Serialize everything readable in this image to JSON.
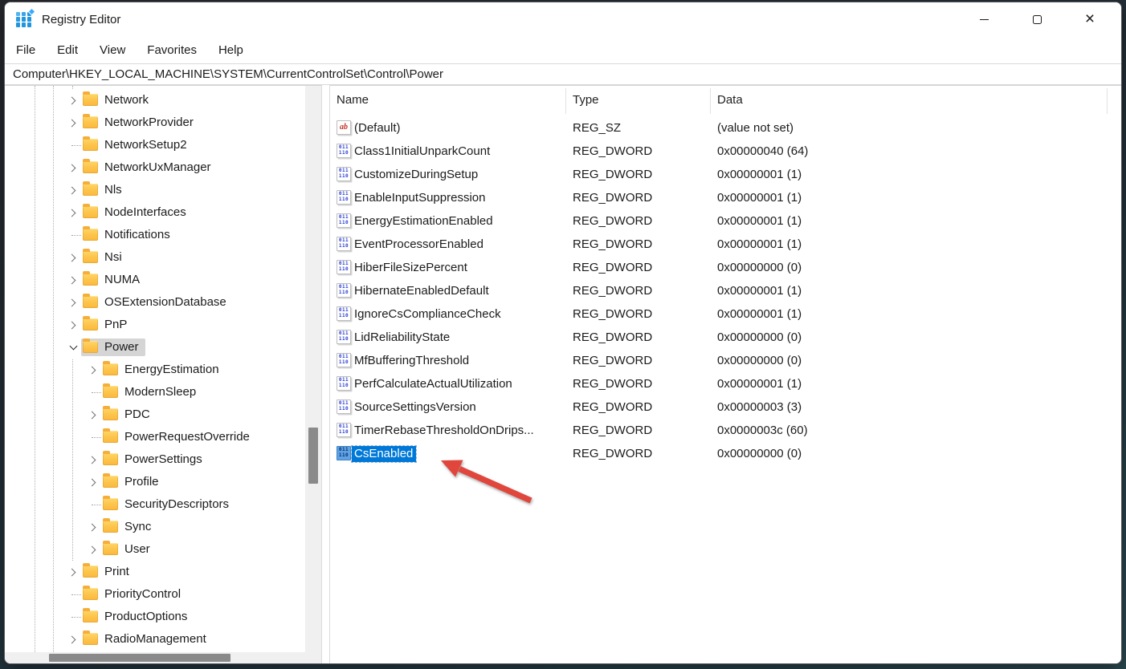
{
  "window": {
    "title": "Registry Editor",
    "controls": {
      "minimize": "minimize",
      "maximize": "maximize",
      "close": "close"
    }
  },
  "menu": {
    "items": [
      "File",
      "Edit",
      "View",
      "Favorites",
      "Help"
    ]
  },
  "address_bar": {
    "value": "Computer\\HKEY_LOCAL_MACHINE\\SYSTEM\\CurrentControlSet\\Control\\Power"
  },
  "tree": {
    "items": [
      {
        "label": "Network",
        "depth": 0,
        "expander": "collapsed",
        "selected": false
      },
      {
        "label": "NetworkProvider",
        "depth": 0,
        "expander": "collapsed",
        "selected": false
      },
      {
        "label": "NetworkSetup2",
        "depth": 0,
        "expander": "none",
        "selected": false
      },
      {
        "label": "NetworkUxManager",
        "depth": 0,
        "expander": "collapsed",
        "selected": false
      },
      {
        "label": "Nls",
        "depth": 0,
        "expander": "collapsed",
        "selected": false
      },
      {
        "label": "NodeInterfaces",
        "depth": 0,
        "expander": "collapsed",
        "selected": false
      },
      {
        "label": "Notifications",
        "depth": 0,
        "expander": "none",
        "selected": false
      },
      {
        "label": "Nsi",
        "depth": 0,
        "expander": "collapsed",
        "selected": false
      },
      {
        "label": "NUMA",
        "depth": 0,
        "expander": "collapsed",
        "selected": false
      },
      {
        "label": "OSExtensionDatabase",
        "depth": 0,
        "expander": "collapsed",
        "selected": false
      },
      {
        "label": "PnP",
        "depth": 0,
        "expander": "collapsed",
        "selected": false
      },
      {
        "label": "Power",
        "depth": 0,
        "expander": "expanded",
        "selected": true
      },
      {
        "label": "EnergyEstimation",
        "depth": 1,
        "expander": "collapsed",
        "selected": false
      },
      {
        "label": "ModernSleep",
        "depth": 1,
        "expander": "none",
        "selected": false
      },
      {
        "label": "PDC",
        "depth": 1,
        "expander": "collapsed",
        "selected": false
      },
      {
        "label": "PowerRequestOverride",
        "depth": 1,
        "expander": "none",
        "selected": false
      },
      {
        "label": "PowerSettings",
        "depth": 1,
        "expander": "collapsed",
        "selected": false
      },
      {
        "label": "Profile",
        "depth": 1,
        "expander": "collapsed",
        "selected": false
      },
      {
        "label": "SecurityDescriptors",
        "depth": 1,
        "expander": "none",
        "selected": false
      },
      {
        "label": "Sync",
        "depth": 1,
        "expander": "collapsed",
        "selected": false
      },
      {
        "label": "User",
        "depth": 1,
        "expander": "collapsed",
        "selected": false
      },
      {
        "label": "Print",
        "depth": 0,
        "expander": "collapsed",
        "selected": false
      },
      {
        "label": "PriorityControl",
        "depth": 0,
        "expander": "none",
        "selected": false
      },
      {
        "label": "ProductOptions",
        "depth": 0,
        "expander": "none",
        "selected": false
      },
      {
        "label": "RadioManagement",
        "depth": 0,
        "expander": "collapsed",
        "selected": false
      }
    ]
  },
  "list": {
    "columns": [
      "Name",
      "Type",
      "Data"
    ],
    "rows": [
      {
        "name": "(Default)",
        "type": "REG_SZ",
        "data": "(value not set)",
        "icon": "reg-sz",
        "selected": false
      },
      {
        "name": "Class1InitialUnparkCount",
        "type": "REG_DWORD",
        "data": "0x00000040 (64)",
        "icon": "reg-dword",
        "selected": false
      },
      {
        "name": "CustomizeDuringSetup",
        "type": "REG_DWORD",
        "data": "0x00000001 (1)",
        "icon": "reg-dword",
        "selected": false
      },
      {
        "name": "EnableInputSuppression",
        "type": "REG_DWORD",
        "data": "0x00000001 (1)",
        "icon": "reg-dword",
        "selected": false
      },
      {
        "name": "EnergyEstimationEnabled",
        "type": "REG_DWORD",
        "data": "0x00000001 (1)",
        "icon": "reg-dword",
        "selected": false
      },
      {
        "name": "EventProcessorEnabled",
        "type": "REG_DWORD",
        "data": "0x00000001 (1)",
        "icon": "reg-dword",
        "selected": false
      },
      {
        "name": "HiberFileSizePercent",
        "type": "REG_DWORD",
        "data": "0x00000000 (0)",
        "icon": "reg-dword",
        "selected": false
      },
      {
        "name": "HibernateEnabledDefault",
        "type": "REG_DWORD",
        "data": "0x00000001 (1)",
        "icon": "reg-dword",
        "selected": false
      },
      {
        "name": "IgnoreCsComplianceCheck",
        "type": "REG_DWORD",
        "data": "0x00000001 (1)",
        "icon": "reg-dword",
        "selected": false
      },
      {
        "name": "LidReliabilityState",
        "type": "REG_DWORD",
        "data": "0x00000000 (0)",
        "icon": "reg-dword",
        "selected": false
      },
      {
        "name": "MfBufferingThreshold",
        "type": "REG_DWORD",
        "data": "0x00000000 (0)",
        "icon": "reg-dword",
        "selected": false
      },
      {
        "name": "PerfCalculateActualUtilization",
        "type": "REG_DWORD",
        "data": "0x00000001 (1)",
        "icon": "reg-dword",
        "selected": false
      },
      {
        "name": "SourceSettingsVersion",
        "type": "REG_DWORD",
        "data": "0x00000003 (3)",
        "icon": "reg-dword",
        "selected": false
      },
      {
        "name": "TimerRebaseThresholdOnDrips...",
        "type": "REG_DWORD",
        "data": "0x0000003c (60)",
        "icon": "reg-dword",
        "selected": false
      },
      {
        "name": "CsEnabled",
        "type": "REG_DWORD",
        "data": "0x00000000 (0)",
        "icon": "reg-dword",
        "selected": true
      }
    ]
  },
  "icons": {
    "reg_sz_glyph": "ab",
    "reg_dword_top": "011",
    "reg_dword_bottom": "110"
  },
  "annotation": {
    "shape": "red-arrow-pointing-to-CsEnabled"
  },
  "colors": {
    "selection-blue": "#0078d7",
    "arrow-red": "#e0463c",
    "title-icon-blue": "#2196dd",
    "inactive-selection-gray": "#d5d5d5"
  }
}
